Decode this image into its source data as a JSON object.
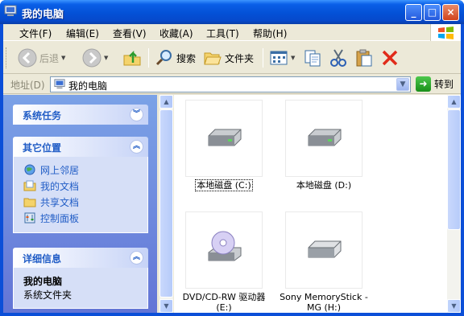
{
  "window": {
    "title": "我的电脑",
    "buttons": {
      "minimize": "_",
      "maximize": "□",
      "close": "×"
    }
  },
  "menubar": {
    "items": [
      "文件(F)",
      "编辑(E)",
      "查看(V)",
      "收藏(A)",
      "工具(T)",
      "帮助(H)"
    ]
  },
  "toolbar": {
    "back": "后退",
    "search": "搜索",
    "folders": "文件夹"
  },
  "address": {
    "label": "地址(D)",
    "value": "我的电脑",
    "go": "转到"
  },
  "sidebar": {
    "system_tasks": {
      "title": "系统任务"
    },
    "other_places": {
      "title": "其它位置",
      "links": [
        "网上邻居",
        "我的文档",
        "共享文档",
        "控制面板"
      ]
    },
    "details": {
      "title": "详细信息",
      "name": "我的电脑",
      "type": "系统文件夹"
    }
  },
  "drives": [
    {
      "label": "本地磁盘 (C:)",
      "icon": "hard-disk-icon",
      "selected": true
    },
    {
      "label": "本地磁盘 (D:)",
      "icon": "hard-disk-icon",
      "selected": false
    },
    {
      "label_line1": "DVD/CD-RW 驱动器",
      "label_line2": "(E:)",
      "icon": "cd-drive-icon"
    },
    {
      "label_line1": "Sony MemoryStick -",
      "label_line2": "MG (H:)",
      "icon": "removable-disk-icon"
    }
  ],
  "colors": {
    "titlebar": "#0451d6",
    "sidebar": "#7ba2e7",
    "panel_title": "#215dc6",
    "chrome": "#ece9d8"
  }
}
